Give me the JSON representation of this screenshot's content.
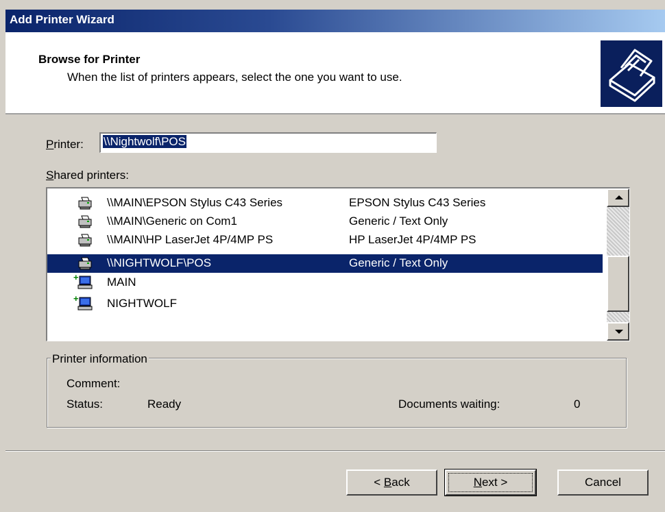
{
  "window": {
    "title": "Add Printer Wizard"
  },
  "header": {
    "title": "Browse for Printer",
    "subtitle": "When the list of printers appears, select the one you want to use."
  },
  "printer_field": {
    "label_hotkey": "P",
    "label_rest": "rinter:",
    "value": "\\\\Nightwolf\\POS"
  },
  "shared_printers": {
    "label_hotkey": "S",
    "label_rest": "hared printers:",
    "items": [
      {
        "name": "\\\\MAIN\\EPSON Stylus C43 Series",
        "model": "EPSON Stylus C43 Series",
        "icon": "printer-icon",
        "selected": false
      },
      {
        "name": "\\\\MAIN\\Generic on Com1",
        "model": "Generic / Text Only",
        "icon": "printer-icon",
        "selected": false
      },
      {
        "name": "\\\\MAIN\\HP LaserJet 4P/4MP PS",
        "model": "HP LaserJet 4P/4MP PS",
        "icon": "printer-icon",
        "selected": false
      },
      {
        "name": "\\\\NIGHTWOLF\\POS",
        "model": "Generic / Text Only",
        "icon": "printer-icon",
        "selected": true
      },
      {
        "name": "MAIN",
        "model": "",
        "icon": "computer-icon",
        "selected": false
      },
      {
        "name": "NIGHTWOLF",
        "model": "",
        "icon": "computer-icon",
        "selected": false
      }
    ]
  },
  "printer_information": {
    "title": "Printer information",
    "comment_label": "Comment:",
    "comment_value": "",
    "status_label": "Status:",
    "status_value": "Ready",
    "docs_label": "Documents waiting:",
    "docs_value": "0"
  },
  "buttons": {
    "back_prefix": "< ",
    "back_hotkey": "B",
    "back_rest": "ack",
    "next_hotkey": "N",
    "next_rest": "ext >",
    "cancel": "Cancel"
  },
  "colors": {
    "selection": "#0a246a",
    "dialog": "#d4d0c8",
    "title_start": "#0a246a",
    "title_end": "#a6caf0"
  }
}
